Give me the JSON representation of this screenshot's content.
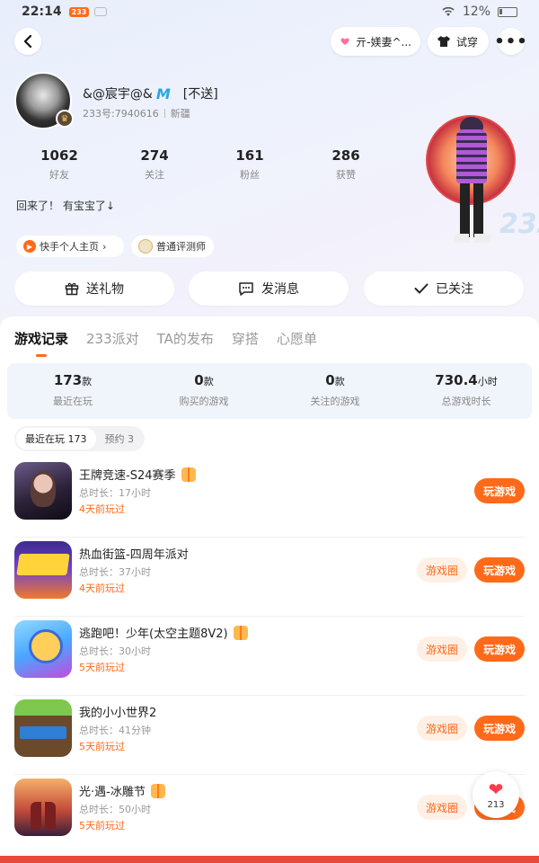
{
  "status_bar": {
    "time": "22:14",
    "app_badge": "233",
    "notif_badge": "",
    "battery": "12%"
  },
  "header": {
    "partner_label": "亓-媄妻^...",
    "tryon_label": "试穿"
  },
  "profile": {
    "username": "&@宸宇@&",
    "username_badge": "M",
    "tag": "[不送]",
    "user_id": "233号:7940616",
    "region": "新疆",
    "bio": "回来了！ 有宝宝了↓",
    "stats": [
      {
        "value": "1062",
        "label": "好友"
      },
      {
        "value": "274",
        "label": "关注"
      },
      {
        "value": "161",
        "label": "粉丝"
      },
      {
        "value": "286",
        "label": "获赞"
      }
    ],
    "tags": [
      {
        "label": "快手个人主页",
        "arrow": "›"
      },
      {
        "label": "普通评测师"
      }
    ]
  },
  "actions": {
    "gift": "送礼物",
    "message": "发消息",
    "followed": "已关注"
  },
  "watermark": "233",
  "tabs": [
    "游戏记录",
    "233派对",
    "TA的发布",
    "穿搭",
    "心愿单"
  ],
  "summary": [
    {
      "value": "173",
      "unit": "款",
      "label": "最近在玩"
    },
    {
      "value": "0",
      "unit": "款",
      "label": "购买的游戏"
    },
    {
      "value": "0",
      "unit": "款",
      "label": "关注的游戏"
    },
    {
      "value": "730.4",
      "unit": "小时",
      "label": "总游戏时长"
    }
  ],
  "subtabs": [
    {
      "label": "最近在玩 173",
      "active": true
    },
    {
      "label": "预约 3",
      "active": false
    }
  ],
  "games": [
    {
      "title": "王牌竞速-S24赛季",
      "gift": true,
      "duration": "总时长：17小时",
      "last_played": "4天前玩过",
      "circle": "",
      "play": "玩游戏"
    },
    {
      "title": "热血街篮-四周年派对",
      "gift": false,
      "duration": "总时长：37小时",
      "last_played": "4天前玩过",
      "circle": "游戏圈",
      "play": "玩游戏"
    },
    {
      "title": "逃跑吧！少年(太空主题8V2)",
      "gift": true,
      "duration": "总时长：30小时",
      "last_played": "5天前玩过",
      "circle": "游戏圈",
      "play": "玩游戏"
    },
    {
      "title": "我的小小世界2",
      "gift": false,
      "duration": "总时长：41分钟",
      "last_played": "5天前玩过",
      "circle": "游戏圈",
      "play": "玩游戏"
    },
    {
      "title": "光·遇-冰雕节",
      "gift": true,
      "duration": "总时长：50小时",
      "last_played": "5天前玩过",
      "circle": "游戏圈",
      "play": "玩游戏"
    }
  ],
  "like_float": {
    "count": "213"
  }
}
